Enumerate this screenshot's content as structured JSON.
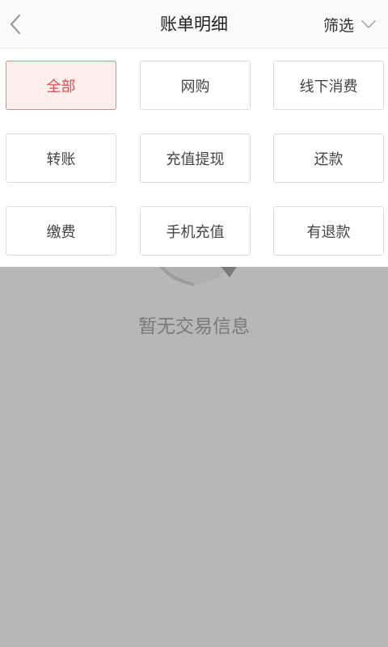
{
  "header": {
    "title": "账单明细",
    "back_icon": "chevron-left-icon",
    "filter_label": "筛选",
    "filter_icon": "chevron-down-icon"
  },
  "filters": {
    "selected_index": 0,
    "selected_color": "#e84c4c",
    "options": [
      {
        "label": "全部"
      },
      {
        "label": "网购"
      },
      {
        "label": "线下消费"
      },
      {
        "label": "转账"
      },
      {
        "label": "充值提现"
      },
      {
        "label": "还款"
      },
      {
        "label": "缴费"
      },
      {
        "label": "手机充值"
      },
      {
        "label": "有退款"
      }
    ]
  },
  "empty_state": {
    "message": "暂无交易信息",
    "icon": "empty-records-icon"
  },
  "overlay_color": "#b7b7b7"
}
